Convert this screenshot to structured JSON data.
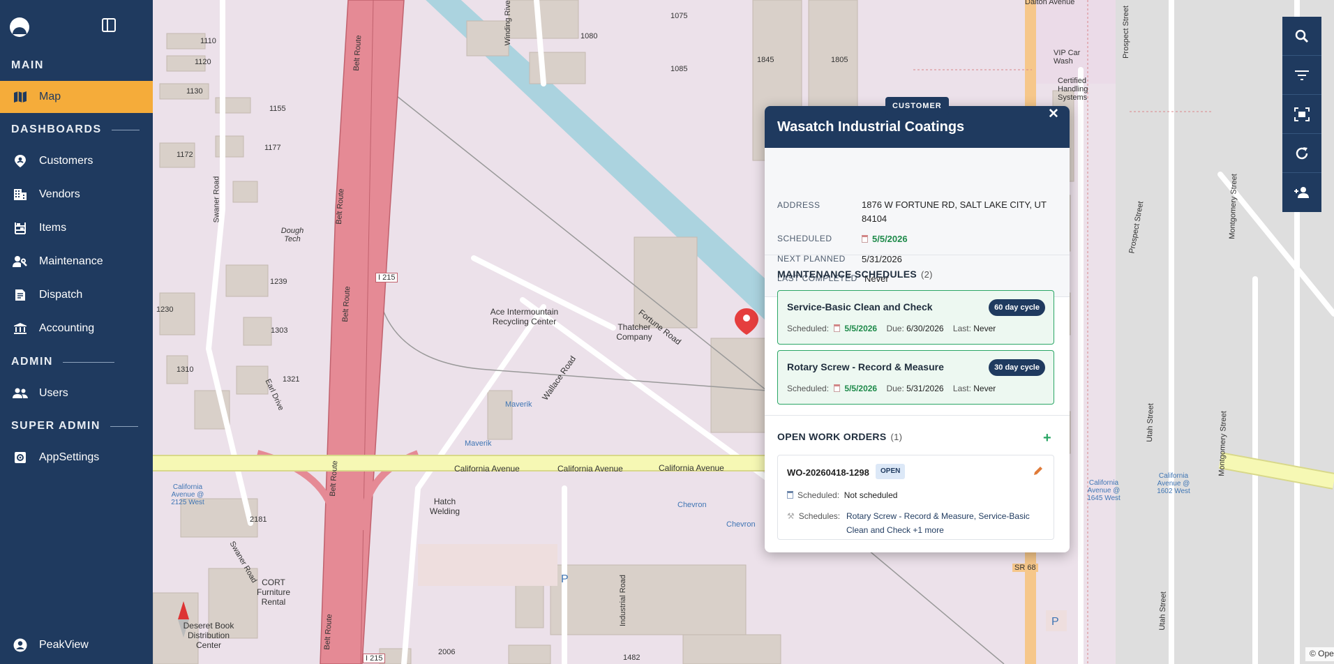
{
  "sidebar": {
    "sections": {
      "main": "MAIN",
      "dashboards": "DASHBOARDS",
      "admin": "ADMIN",
      "super_admin": "SUPER ADMIN"
    },
    "items": {
      "map": "Map",
      "customers": "Customers",
      "vendors": "Vendors",
      "items": "Items",
      "maintenance": "Maintenance",
      "dispatch": "Dispatch",
      "accounting": "Accounting",
      "users": "Users",
      "appsettings": "AppSettings"
    },
    "user": "PeakView",
    "active_color": "#f5ac3a",
    "bg_color": "#1f3a5f"
  },
  "map": {
    "labels": {
      "belt_route": "Belt Route",
      "i215": "I 215",
      "ace": "Ace Intermountain Recycling Center",
      "thatcher": "Thatcher Company",
      "fortune": "Fortune Road",
      "wallace": "Wallace Road",
      "california": "California Avenue",
      "maverik": "Maverik",
      "chevron": "Chevron",
      "hatch": "Hatch Welding",
      "cort": "CORT Furniture Rental",
      "deseret": "Deseret Book Distribution Center",
      "industrial": "Industrial Road",
      "swaner": "Swaner Road",
      "earl": "Earl Drive",
      "dough": "Dough Tech",
      "winding": "Winding River",
      "prospect": "Prospect Street",
      "montgomery": "Montgomery Street",
      "utah": "Utah Street",
      "dalton": "Dalton Avenue",
      "vip": "VIP Car Wash",
      "certified": "Certified Handling Systems",
      "sr68": "SR 68",
      "bus_2125": "California Avenue @ 2125 West",
      "bus_1645": "California Avenue @ 1645 West",
      "bus_1602": "California Avenue @ 1602 West",
      "bldg_1845": "1845",
      "bldg_1805": "1805",
      "bldg_1075": "1075",
      "bldg_1080": "1080",
      "bldg_1085": "1085",
      "bldg_1110": "1110",
      "bldg_1120": "1120",
      "bldg_1130": "1130",
      "bldg_1155": "1155",
      "bldg_1172": "1172",
      "bldg_1177": "1177",
      "bldg_1239": "1239",
      "bldg_1230": "1230",
      "bldg_1303": "1303",
      "bldg_1310": "1310",
      "bldg_1321": "1321",
      "bldg_2181": "2181",
      "bldg_2006": "2006",
      "bldg_1482": "1482"
    },
    "attribution": "© OpenStreetMap contributors | MapLibre",
    "info_glyph": "i",
    "parking": "P"
  },
  "toolbar": {
    "tools": [
      "search-icon",
      "filter-icon",
      "fit-bounds-icon",
      "refresh-icon",
      "add-person-icon"
    ]
  },
  "popup": {
    "tag": "CUSTOMER",
    "title": "Wasatch Industrial Coatings",
    "close": "✕",
    "address_label": "ADDRESS",
    "address": "1876 W FORTUNE RD, SALT LAKE CITY, UT 84104",
    "scheduled_label": "SCHEDULED",
    "scheduled": "5/5/2026",
    "next_planned_label": "NEXT PLANNED",
    "next_planned": "5/31/2026",
    "last_completed_label": "LAST COMPLETED",
    "last_completed": "Never",
    "schedules_title": "MAINTENANCE SCHEDULES",
    "schedules_count": "(2)",
    "schedules": [
      {
        "name": "Service-Basic Clean and Check",
        "cycle": "60 day cycle",
        "scheduled_label": "Scheduled:",
        "scheduled": "5/5/2026",
        "due_label": "Due:",
        "due": "6/30/2026",
        "last_label": "Last:",
        "last": "Never"
      },
      {
        "name": "Rotary Screw - Record & Measure",
        "cycle": "30 day cycle",
        "scheduled_label": "Scheduled:",
        "scheduled": "5/5/2026",
        "due_label": "Due:",
        "due": "5/31/2026",
        "last_label": "Last:",
        "last": "Never"
      }
    ],
    "work_orders_title": "OPEN WORK ORDERS",
    "work_orders_count": "(1)",
    "add_glyph": "+",
    "work_order": {
      "id": "WO-20260418-1298",
      "status": "OPEN",
      "scheduled_label": "Scheduled:",
      "scheduled": "Not scheduled",
      "schedules_label": "Schedules:",
      "schedules": "Rotary Screw - Record & Measure, Service-Basic Clean and Check +1 more"
    }
  }
}
